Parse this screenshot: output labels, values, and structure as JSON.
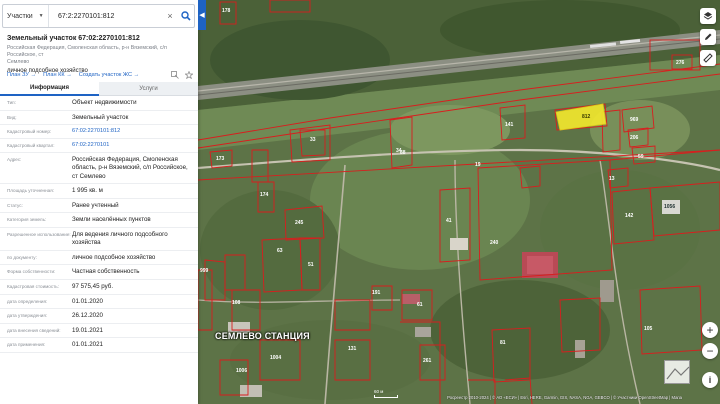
{
  "search": {
    "type_label": "Участки",
    "query": "67:2:2270101:812"
  },
  "object": {
    "title": "Земельный участок 67:02:2270101:812",
    "address_line1": "Российская Федерация, Смоленская область, р-н Вяземский, с/п Российское, ст",
    "address_line2": "Семлево",
    "use": "личное подсобное хозяйство"
  },
  "links": {
    "plan_zu": "План ЗУ",
    "plan_kk": "План КК",
    "create_zhs": "Создать участок ЖС"
  },
  "tabs": {
    "info": "Информация",
    "services": "Услуги"
  },
  "attributes": [
    {
      "label": "Тип:",
      "value": "Объект недвижимости"
    },
    {
      "label": "Вид:",
      "value": "Земельный участок"
    },
    {
      "label": "Кадастровый номер:",
      "value": "67:02:2270101:812",
      "link": true
    },
    {
      "label": "Кадастровый квартал:",
      "value": "67:02:2270101",
      "link": true
    },
    {
      "label": "Адрес:",
      "value": "Российская Федерация, Смоленская область, р-н Вяземский, с/п Российское, ст Семлево"
    },
    {
      "label": "Площадь уточненная:",
      "value": "1 995 кв. м"
    },
    {
      "label": "Статус:",
      "value": "Ранее учтенный"
    },
    {
      "label": "Категория земель:",
      "value": "Земли населённых пунктов"
    },
    {
      "label": "Разрешенное использование:",
      "value": "Для ведения личного подсобного хозяйства"
    },
    {
      "label": "по документу:",
      "value": "личное подсобное хозяйство"
    },
    {
      "label": "Форма собственности:",
      "value": "Частная собственность"
    },
    {
      "label": "Кадастровая стоимость:",
      "value": "97 575,45 руб."
    },
    {
      "label": "дата определения:",
      "value": "01.01.2020"
    },
    {
      "label": "дата утверждения:",
      "value": "26.12.2020"
    },
    {
      "label": "дата внесения сведений:",
      "value": "19.01.2021"
    },
    {
      "label": "дата применения:",
      "value": "01.01.2021"
    }
  ],
  "map": {
    "station_label": "СЕМЛЕВО СТАНЦИЯ",
    "highlight_label": "812",
    "parcel_labels": [
      "178",
      "276",
      "141",
      "969",
      "206",
      "59",
      "13",
      "142",
      "1056",
      "240",
      "245",
      "88",
      "19",
      "61",
      "63",
      "51",
      "191",
      "173",
      "105",
      "108",
      "1006",
      "999",
      "1004",
      "34",
      "174",
      "261",
      "131",
      "33",
      "41",
      "81"
    ],
    "scale": "60 м",
    "attribution": "Росреестр  2010-2024 | © АО «ЕСИ» | Esri, HERE, Garmin, GIS, NASA, NGA, GEBCO | © Участники OpenStreetMap | Мапа"
  },
  "colors": {
    "accent": "#1e63c4",
    "parcel_border": "#d81e1e",
    "highlight_fill": "#f4e92c"
  }
}
